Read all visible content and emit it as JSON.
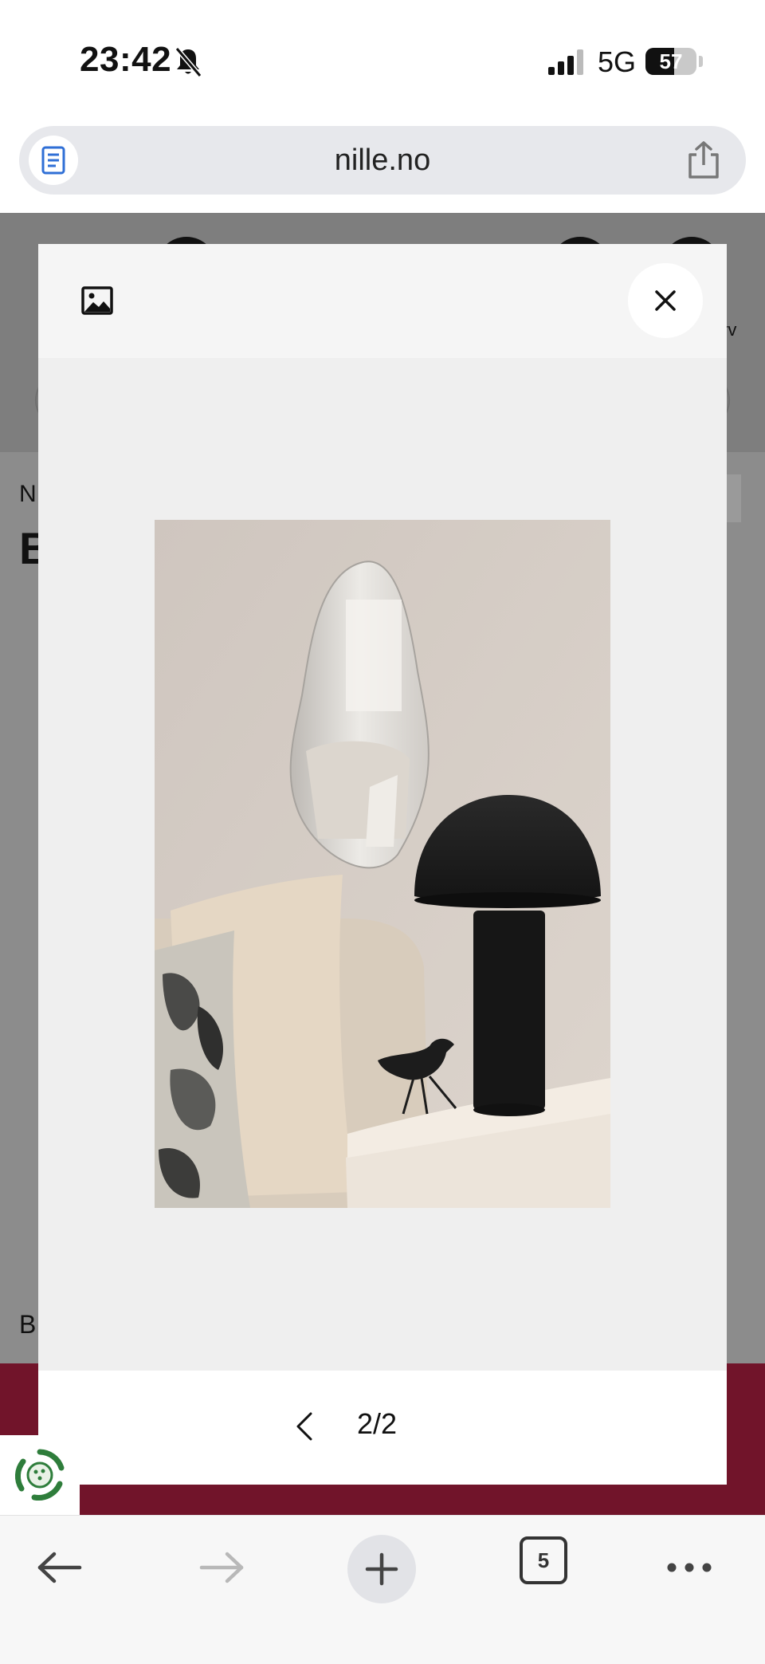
{
  "status_bar": {
    "time": "23:42",
    "network": "5G",
    "battery_level": "57",
    "battery_fraction": 0.57
  },
  "browser": {
    "url": "nille.no",
    "open_tabs_count": "5"
  },
  "page_behind": {
    "breadcrumb_start": "N",
    "title_start": "B",
    "footer_text_start": "B",
    "side_label_fragment": "rv"
  },
  "modal": {
    "page_counter": "2/2",
    "current_page": 2,
    "total_pages": 2
  },
  "icons": {
    "reader": "reader-icon",
    "share": "share-icon",
    "image": "image-icon",
    "close": "close-icon",
    "prev": "chevron-left-icon",
    "back": "arrow-left-icon",
    "forward": "arrow-right-icon",
    "plus": "plus-icon",
    "more": "more-icon",
    "eco": "recycle-badge-icon"
  },
  "colors": {
    "brand_footer": "#71142a",
    "reader_icon": "#2f6fd6",
    "eco_green": "#2e7d3b"
  }
}
